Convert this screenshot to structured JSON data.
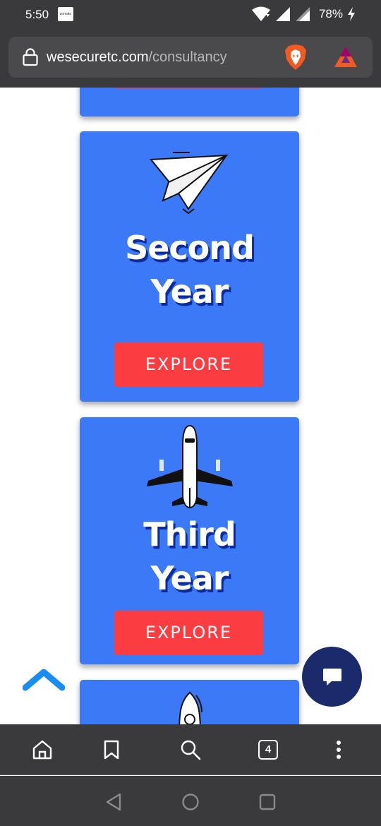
{
  "status_bar": {
    "time": "5:50",
    "notification_app": "zomato",
    "battery": "78%"
  },
  "browser": {
    "url_domain": "wesecuretc.com",
    "url_path": "/consultancy",
    "tab_count": "4"
  },
  "cards": [
    {
      "title_line1": "",
      "title_line2": "",
      "button": ""
    },
    {
      "icon": "paper-plane-icon",
      "title_line1": "Second",
      "title_line2": "Year",
      "button": "EXPLORE"
    },
    {
      "icon": "airplane-icon",
      "title_line1": "Third",
      "title_line2": "Year",
      "button": "EXPLORE"
    },
    {
      "icon": "rocket-icon"
    }
  ],
  "colors": {
    "card_blue": "#3b79f7",
    "button_red": "#fb3c41",
    "chat_navy": "#1b2a6b",
    "scroll_up_blue": "#1a8ef0",
    "chrome_dark": "#3a3a3c"
  }
}
